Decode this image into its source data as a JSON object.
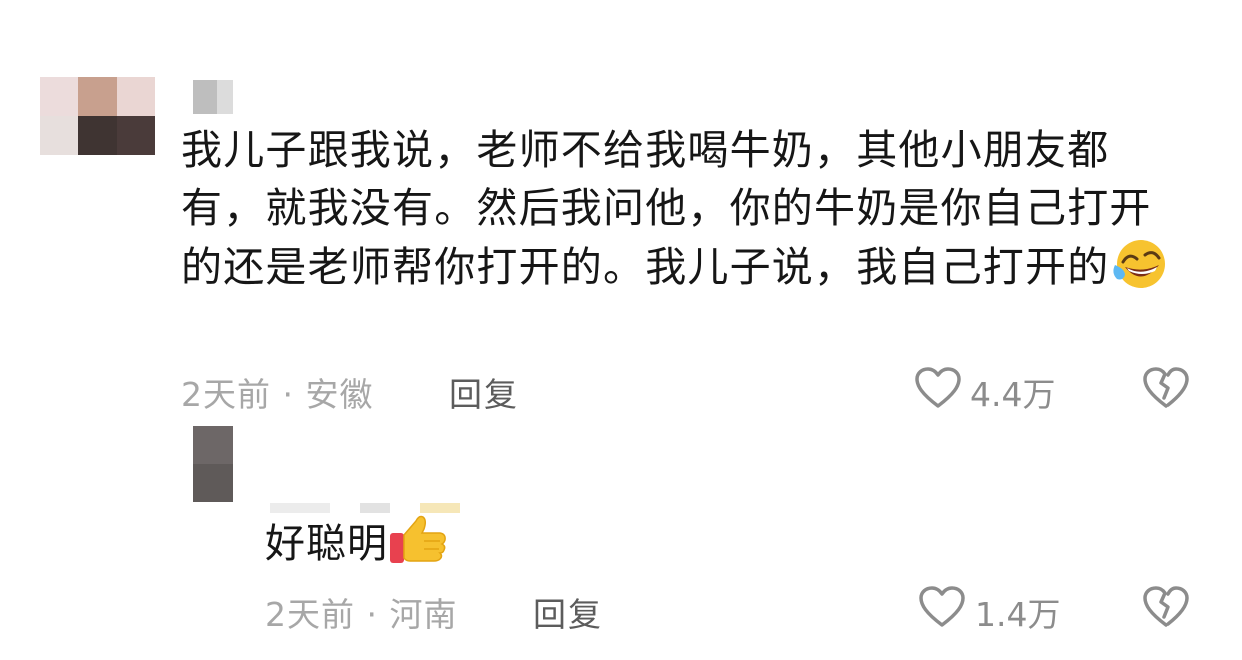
{
  "comment": {
    "text": "我儿子跟我说，老师不给我喝牛奶，其他小朋友都有，就我没有。然后我问他，你的牛奶是你自己打开的还是老师帮你打开的。我儿子说，我自己打开的",
    "emoji": "laughing-with-tears-emoji",
    "time_location": "2天前 · 安徽",
    "reply_label": "回复",
    "likes": "4.4万",
    "icons": {
      "like": "heart-outline-icon",
      "dislike": "broken-heart-icon"
    }
  },
  "reply": {
    "text": "好聪明",
    "emoji": "thumbs-up-emoji",
    "time_location": "2天前 · 河南",
    "reply_label": "回复",
    "likes": "1.4万",
    "icons": {
      "like": "heart-outline-icon",
      "dislike": "broken-heart-icon"
    }
  },
  "colors": {
    "text": "#161616",
    "meta": "#a7a7a7",
    "reply_button": "#5c5c5c",
    "icon": "#8c8c8c"
  }
}
